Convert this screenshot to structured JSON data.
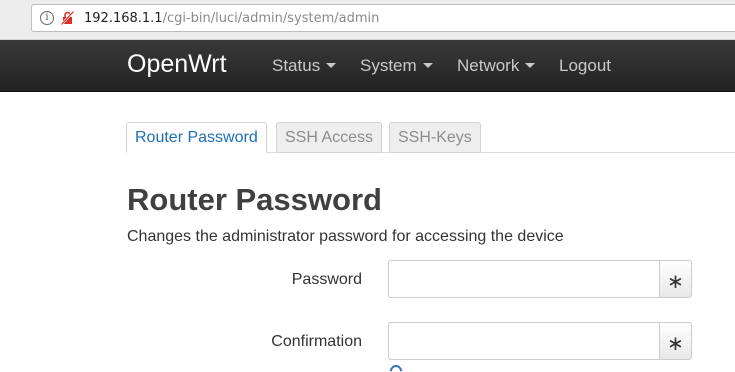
{
  "browser": {
    "url_host": "192.168.1.1",
    "url_path": "/cgi-bin/luci/admin/system/admin",
    "info_icon": "info-circle-icon",
    "security_icon": "insecure-lock-icon"
  },
  "navbar": {
    "brand": "OpenWrt",
    "items": [
      {
        "label": "Status",
        "has_dropdown": true
      },
      {
        "label": "System",
        "has_dropdown": true
      },
      {
        "label": "Network",
        "has_dropdown": true
      },
      {
        "label": "Logout",
        "has_dropdown": false
      }
    ]
  },
  "tabs": [
    {
      "label": "Router Password",
      "active": true
    },
    {
      "label": "SSH Access",
      "active": false
    },
    {
      "label": "SSH-Keys",
      "active": false
    }
  ],
  "section": {
    "title": "Router Password",
    "description": "Changes the administrator password for accessing the device"
  },
  "fields": {
    "password": {
      "label": "Password",
      "value": "",
      "reveal": "∗"
    },
    "confirmation": {
      "label": "Confirmation",
      "value": "",
      "reveal": "∗"
    }
  },
  "colors": {
    "navbar": "#222222",
    "accent": "#1c6fb6",
    "title": "#404040"
  }
}
